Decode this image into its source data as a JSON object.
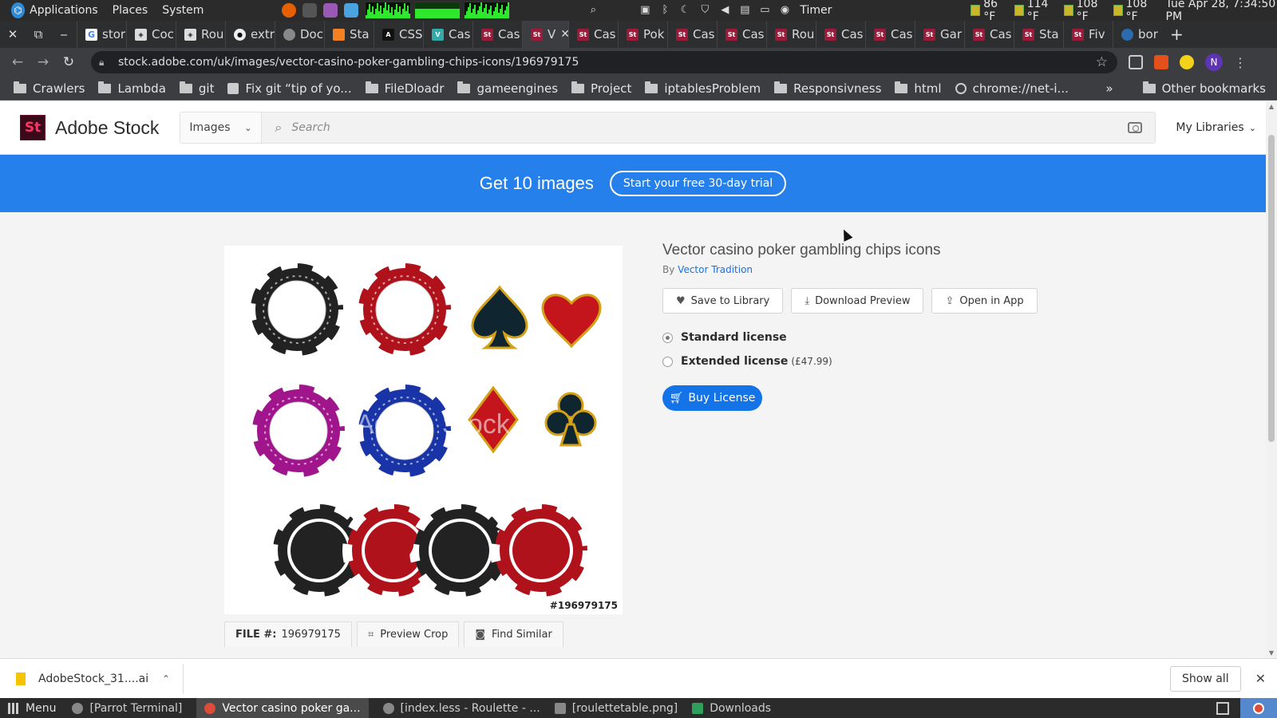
{
  "os_panel": {
    "menus": [
      "Applications",
      "Places",
      "System"
    ],
    "timer_label": "Timer",
    "weather": [
      "86 °F",
      "114 °F",
      "108 °F",
      "108 °F"
    ],
    "clock": "Tue Apr 28, 7:34:50 PM"
  },
  "tabs": [
    {
      "label": "stor",
      "icon": "google-icon",
      "fav": "g",
      "fav_text": "G"
    },
    {
      "label": "Coc",
      "icon": "codepen-icon",
      "fav": "cp",
      "fav_text": "◈"
    },
    {
      "label": "Rou",
      "icon": "codepen-icon",
      "fav": "cp",
      "fav_text": "◈"
    },
    {
      "label": "extr",
      "icon": "github-icon",
      "fav": "gh",
      "fav_text": "●"
    },
    {
      "label": "Doc",
      "icon": "docs-icon",
      "fav": "ds",
      "fav_text": ""
    },
    {
      "label": "Sta",
      "icon": "stackoverflow-icon",
      "fav": "so",
      "fav_text": ""
    },
    {
      "label": "CSS",
      "icon": "css-icon",
      "fav": "css",
      "fav_text": "A"
    },
    {
      "label": "Cas",
      "icon": "vue-icon",
      "fav": "vu",
      "fav_text": "V"
    },
    {
      "label": "Cas",
      "icon": "adobe-stock-icon",
      "fav": "st",
      "fav_text": "St"
    },
    {
      "label": "V",
      "icon": "adobe-stock-icon",
      "fav": "st",
      "fav_text": "St",
      "active": true
    },
    {
      "label": "Cas",
      "icon": "adobe-stock-icon",
      "fav": "st",
      "fav_text": "St"
    },
    {
      "label": "Pok",
      "icon": "adobe-stock-icon",
      "fav": "st",
      "fav_text": "St"
    },
    {
      "label": "Cas",
      "icon": "adobe-stock-icon",
      "fav": "st",
      "fav_text": "St"
    },
    {
      "label": "Cas",
      "icon": "adobe-stock-icon",
      "fav": "st",
      "fav_text": "St"
    },
    {
      "label": "Rou",
      "icon": "adobe-stock-icon",
      "fav": "st",
      "fav_text": "St"
    },
    {
      "label": "Cas",
      "icon": "adobe-stock-icon",
      "fav": "st",
      "fav_text": "St"
    },
    {
      "label": "Cas",
      "icon": "adobe-stock-icon",
      "fav": "st",
      "fav_text": "St"
    },
    {
      "label": "Gar",
      "icon": "adobe-stock-icon",
      "fav": "st",
      "fav_text": "St"
    },
    {
      "label": "Cas",
      "icon": "adobe-stock-icon",
      "fav": "st",
      "fav_text": "St"
    },
    {
      "label": "Sta",
      "icon": "adobe-stock-icon",
      "fav": "st",
      "fav_text": "St"
    },
    {
      "label": "Fiv",
      "icon": "adobe-stock-icon",
      "fav": "st",
      "fav_text": "St"
    },
    {
      "label": "bor",
      "icon": "bootstrap-icon",
      "fav": "bo",
      "fav_text": ""
    }
  ],
  "address_bar": {
    "url": "stock.adobe.com/uk/images/vector-casino-poker-gambling-chips-icons/196979175",
    "profile_initial": "N"
  },
  "bookmarks": [
    {
      "label": "Crawlers",
      "type": "folder"
    },
    {
      "label": "Lambda",
      "type": "folder"
    },
    {
      "label": "git",
      "type": "folder"
    },
    {
      "label": "Fix git “tip of yo...",
      "type": "page"
    },
    {
      "label": "FileDloadr",
      "type": "folder"
    },
    {
      "label": "gameengines",
      "type": "folder"
    },
    {
      "label": "Project",
      "type": "folder"
    },
    {
      "label": "iptablesProblem",
      "type": "folder"
    },
    {
      "label": "Responsivness",
      "type": "folder"
    },
    {
      "label": "html",
      "type": "folder"
    },
    {
      "label": "chrome://net-i...",
      "type": "globe"
    }
  ],
  "bookmarks_more": "»",
  "bookmarks_other": "Other bookmarks",
  "stock": {
    "logo_text": "St",
    "brand": "Adobe Stock",
    "search_type": "Images",
    "search_placeholder": "Search",
    "my_libraries": "My Libraries"
  },
  "promo": {
    "text": "Get 10 images",
    "button": "Start your free 30-day trial"
  },
  "asset": {
    "id_label": "#196979175",
    "watermark": "Adobe Stock",
    "title": "Vector casino poker gambling chips icons",
    "by_prefix": "By",
    "author": "Vector Tradition",
    "actions": [
      "Save to Library",
      "Download Preview",
      "Open in App"
    ],
    "licenses": [
      {
        "name": "Standard license",
        "price": "",
        "selected": true
      },
      {
        "name": "Extended license",
        "price": "(£47.99)",
        "selected": false
      }
    ],
    "buy_label": "Buy License",
    "file_label": "FILE #:",
    "file_number": "196979175",
    "preview_crop": "Preview Crop",
    "find_similar": "Find Similar"
  },
  "downloads": {
    "file": "AdobeStock_31....ai",
    "show_all": "Show all"
  },
  "taskbar": {
    "menu": "Menu",
    "items": [
      "[Parrot Terminal]",
      "Vector casino poker ga...",
      "[index.less - Roulette - ...",
      "[roulettetable.png]",
      "Downloads"
    ]
  },
  "colors": {
    "adobe_blue": "#2680eb",
    "link_blue": "#1473e6",
    "stock_red": "#9b1c3a"
  }
}
